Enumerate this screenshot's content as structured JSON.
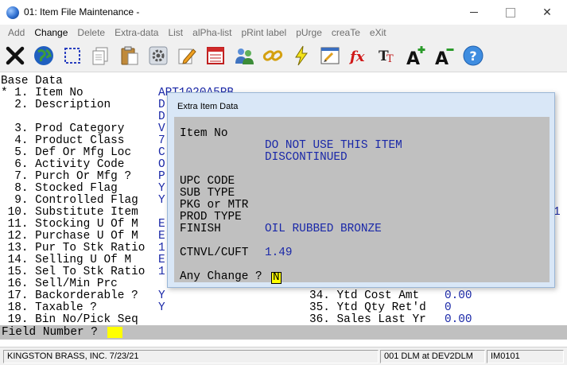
{
  "window": {
    "title": "01: Item File Maintenance -"
  },
  "menu": [
    {
      "label": "Add",
      "active": false
    },
    {
      "label": "Change",
      "active": true
    },
    {
      "label": "Delete",
      "active": false
    },
    {
      "label": "Extra-data",
      "active": false
    },
    {
      "label": "List",
      "active": false
    },
    {
      "label": "alPha-list",
      "active": false
    },
    {
      "label": "pRint label",
      "active": false
    },
    {
      "label": "pUrge",
      "active": false
    },
    {
      "label": "creaTe",
      "active": false
    },
    {
      "label": "eXit",
      "active": false
    }
  ],
  "toolbar": [
    {
      "icon": "exit-icon"
    },
    {
      "icon": "globe-icon"
    },
    {
      "icon": "select-box-icon"
    },
    {
      "icon": "copy-icon"
    },
    {
      "icon": "paste-icon"
    },
    {
      "icon": "settings-icon"
    },
    {
      "icon": "edit-icon"
    },
    {
      "icon": "calendar-icon"
    },
    {
      "icon": "users-icon"
    },
    {
      "icon": "link-icon"
    },
    {
      "icon": "lightning-icon"
    },
    {
      "icon": "window-icon"
    },
    {
      "icon": "function-icon"
    },
    {
      "icon": "text-format-icon"
    },
    {
      "icon": "font-increase-icon"
    },
    {
      "icon": "font-decrease-icon"
    },
    {
      "icon": "help-icon"
    }
  ],
  "form": {
    "section_title": "Base Data",
    "fields_left": [
      {
        "label": "* 1. Item No",
        "value": "ART1020A5PB"
      },
      {
        "label": "  2. Description",
        "value": "D"
      },
      {
        "label": "",
        "value": "D"
      },
      {
        "label": "  3. Prod Category",
        "value": "V"
      },
      {
        "label": "  4. Product Class",
        "value": "7"
      },
      {
        "label": "  5. Def Or Mfg Loc",
        "value": "C"
      },
      {
        "label": "  6. Activity Code",
        "value": "O"
      },
      {
        "label": "  7. Purch Or Mfg ?",
        "value": "P"
      },
      {
        "label": "  8. Stocked Flag",
        "value": "Y"
      },
      {
        "label": "  9. Controlled Flag",
        "value": "Y"
      },
      {
        "label": " 10. Substitute Item",
        "value": ""
      },
      {
        "label": " 11. Stocking U Of M",
        "value": "E"
      },
      {
        "label": " 12. Purchase U Of M",
        "value": "E"
      },
      {
        "label": " 13. Pur To Stk Ratio",
        "value": "1"
      },
      {
        "label": " 14. Selling U Of M",
        "value": "E"
      },
      {
        "label": " 15. Sel To Stk Ratio",
        "value": "1"
      },
      {
        "label": " 16. Sell/Min Prc",
        "value": ""
      },
      {
        "label": " 17. Backorderable ?",
        "value": "Y"
      },
      {
        "label": " 18. Taxable ?",
        "value": "Y"
      },
      {
        "label": " 19. Bin No/Pick Seq",
        "value": ""
      }
    ],
    "right_edge_digit": "1",
    "fields_right": [
      {
        "label": "34. Ytd Cost Amt",
        "value": "0.00"
      },
      {
        "label": "35. Ytd Qty Ret'd",
        "value": "0"
      },
      {
        "label": "36. Sales Last Yr",
        "value": "0.00"
      }
    ],
    "prompt": "Field Number ?"
  },
  "dialog": {
    "title": "Extra Item Data",
    "item_no_label": "Item No",
    "desc_line1": "DO NOT USE THIS ITEM",
    "desc_line2": "DISCONTINUED",
    "upc_label": "UPC CODE",
    "subtype_label": "SUB TYPE",
    "pkg_label": "PKG or MTR",
    "prodtype_label": "PROD TYPE",
    "finish_label": "FINISH",
    "finish_value": "OIL RUBBED BRONZE",
    "ctnvl_label": "CTNVL/CUFT",
    "ctnvl_value": "1.49",
    "any_change_label": "Any Change ?",
    "any_change_value": "N"
  },
  "status": {
    "company": "KINGSTON BRASS, INC. 7/23/21",
    "session": "001 DLM at DEV2DLM",
    "program": "IM0101"
  },
  "colors": {
    "terminal_value": "#1a28a8",
    "dialog_frame": "#d9e7f7",
    "dialog_body": "#c0c0c0",
    "input_highlight": "#ffff00"
  }
}
